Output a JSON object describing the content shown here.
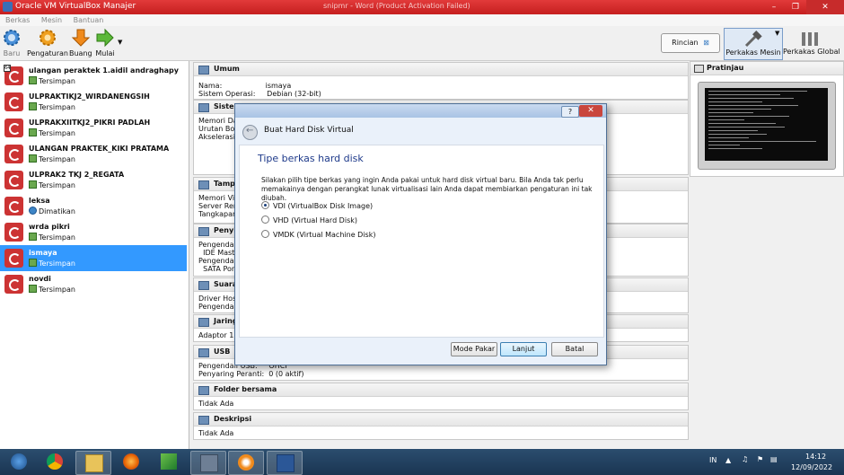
{
  "window": {
    "title": "Oracle VM VirtualBox Manajer",
    "faded_title": "snipmr - Word (Product Activation Failed)",
    "controls": [
      "–",
      "❐",
      "✕"
    ]
  },
  "menu": [
    "Berkas",
    "Mesin",
    "Bantuan"
  ],
  "toolbar": {
    "baru": "Baru",
    "pengaturan": "Pengaturan",
    "buang": "Buang",
    "mulai": "Mulai",
    "rincian": "Rincian",
    "perkakas_mesin": "Perkakas Mesin",
    "perkakas_global": "Perkakas Global"
  },
  "vms": [
    {
      "name": "ulangan peraktek 1.aidil andraghapy",
      "state": "Tersimpan",
      "badge": "64"
    },
    {
      "name": "ULPRAKTIKJ2_WIRDANENGSIH",
      "state": "Tersimpan"
    },
    {
      "name": "ULPRAKXIITKJ2_PIKRI PADLAH",
      "state": "Tersimpan"
    },
    {
      "name": "ULANGAN PRAKTEK_KIKI PRATAMA",
      "state": "Tersimpan"
    },
    {
      "name": "ULPRAK2 TKJ 2_REGATA",
      "state": "Tersimpan"
    },
    {
      "name": "leksa",
      "state": "Dimatikan"
    },
    {
      "name": "wrda pikri",
      "state": "Tersimpan"
    },
    {
      "name": "ismaya",
      "state": "Tersimpan"
    },
    {
      "name": "novdi",
      "state": "Tersimpan"
    }
  ],
  "details": {
    "umum": {
      "title": "Umum",
      "rows": [
        "Nama:                   ismaya",
        "Sistem Operasi:     Debian (32-bit)"
      ]
    },
    "sistem": {
      "title": "Sistem",
      "rows": [
        "Memori Dasar",
        "Urutan Boot",
        "Akselerasi:"
      ]
    },
    "tampilan": {
      "title": "Tampilan",
      "rows": [
        "Memori Video",
        "Server Remote",
        "Tangkapan V"
      ]
    },
    "penyimpanan": {
      "title": "Penyimpanan",
      "rows": [
        "Pengendali: I",
        "  IDE Master",
        "Pengendali: S",
        "  SATA Port 0"
      ]
    },
    "suara": {
      "title": "Suara",
      "rows": [
        "Driver Host:",
        "Pengendali:"
      ]
    },
    "jaringan": {
      "title": "Jaringan",
      "rows": [
        "Adaptor 1:"
      ]
    },
    "usb": {
      "title": "USB",
      "rows": [
        "Pengendali USB:     OHCI",
        "Penyaring Peranti:  0 (0 aktif)"
      ]
    },
    "folder": {
      "title": "Folder bersama",
      "rows": [
        "Tidak Ada"
      ]
    },
    "deskripsi": {
      "title": "Deskripsi",
      "rows": [
        "Tidak Ada"
      ]
    }
  },
  "preview": {
    "title": "Pratinjau"
  },
  "dialog": {
    "help": "?",
    "close": "✕",
    "window_title": "Buat Hard Disk Virtual",
    "heading": "Tipe berkas hard disk",
    "description": "Silakan pilih tipe berkas yang ingin Anda pakai untuk hard disk virtual baru. Bila Anda tak perlu memakainya dengan perangkat lunak virtualisasi lain Anda dapat membiarkan pengaturan ini tak diubah.",
    "options": [
      {
        "label": "VDI (VirtualBox Disk Image)",
        "selected": true
      },
      {
        "label": "VHD (Virtual Hard Disk)",
        "selected": false
      },
      {
        "label": "VMDK (Virtual Machine Disk)",
        "selected": false
      }
    ],
    "buttons": {
      "mode_pakar": "Mode Pakar",
      "lanjut": "Lanjut",
      "batal": "Batal"
    }
  },
  "taskbar": {
    "lang": "IN",
    "time": "14:12",
    "date": "12/09/2022"
  }
}
